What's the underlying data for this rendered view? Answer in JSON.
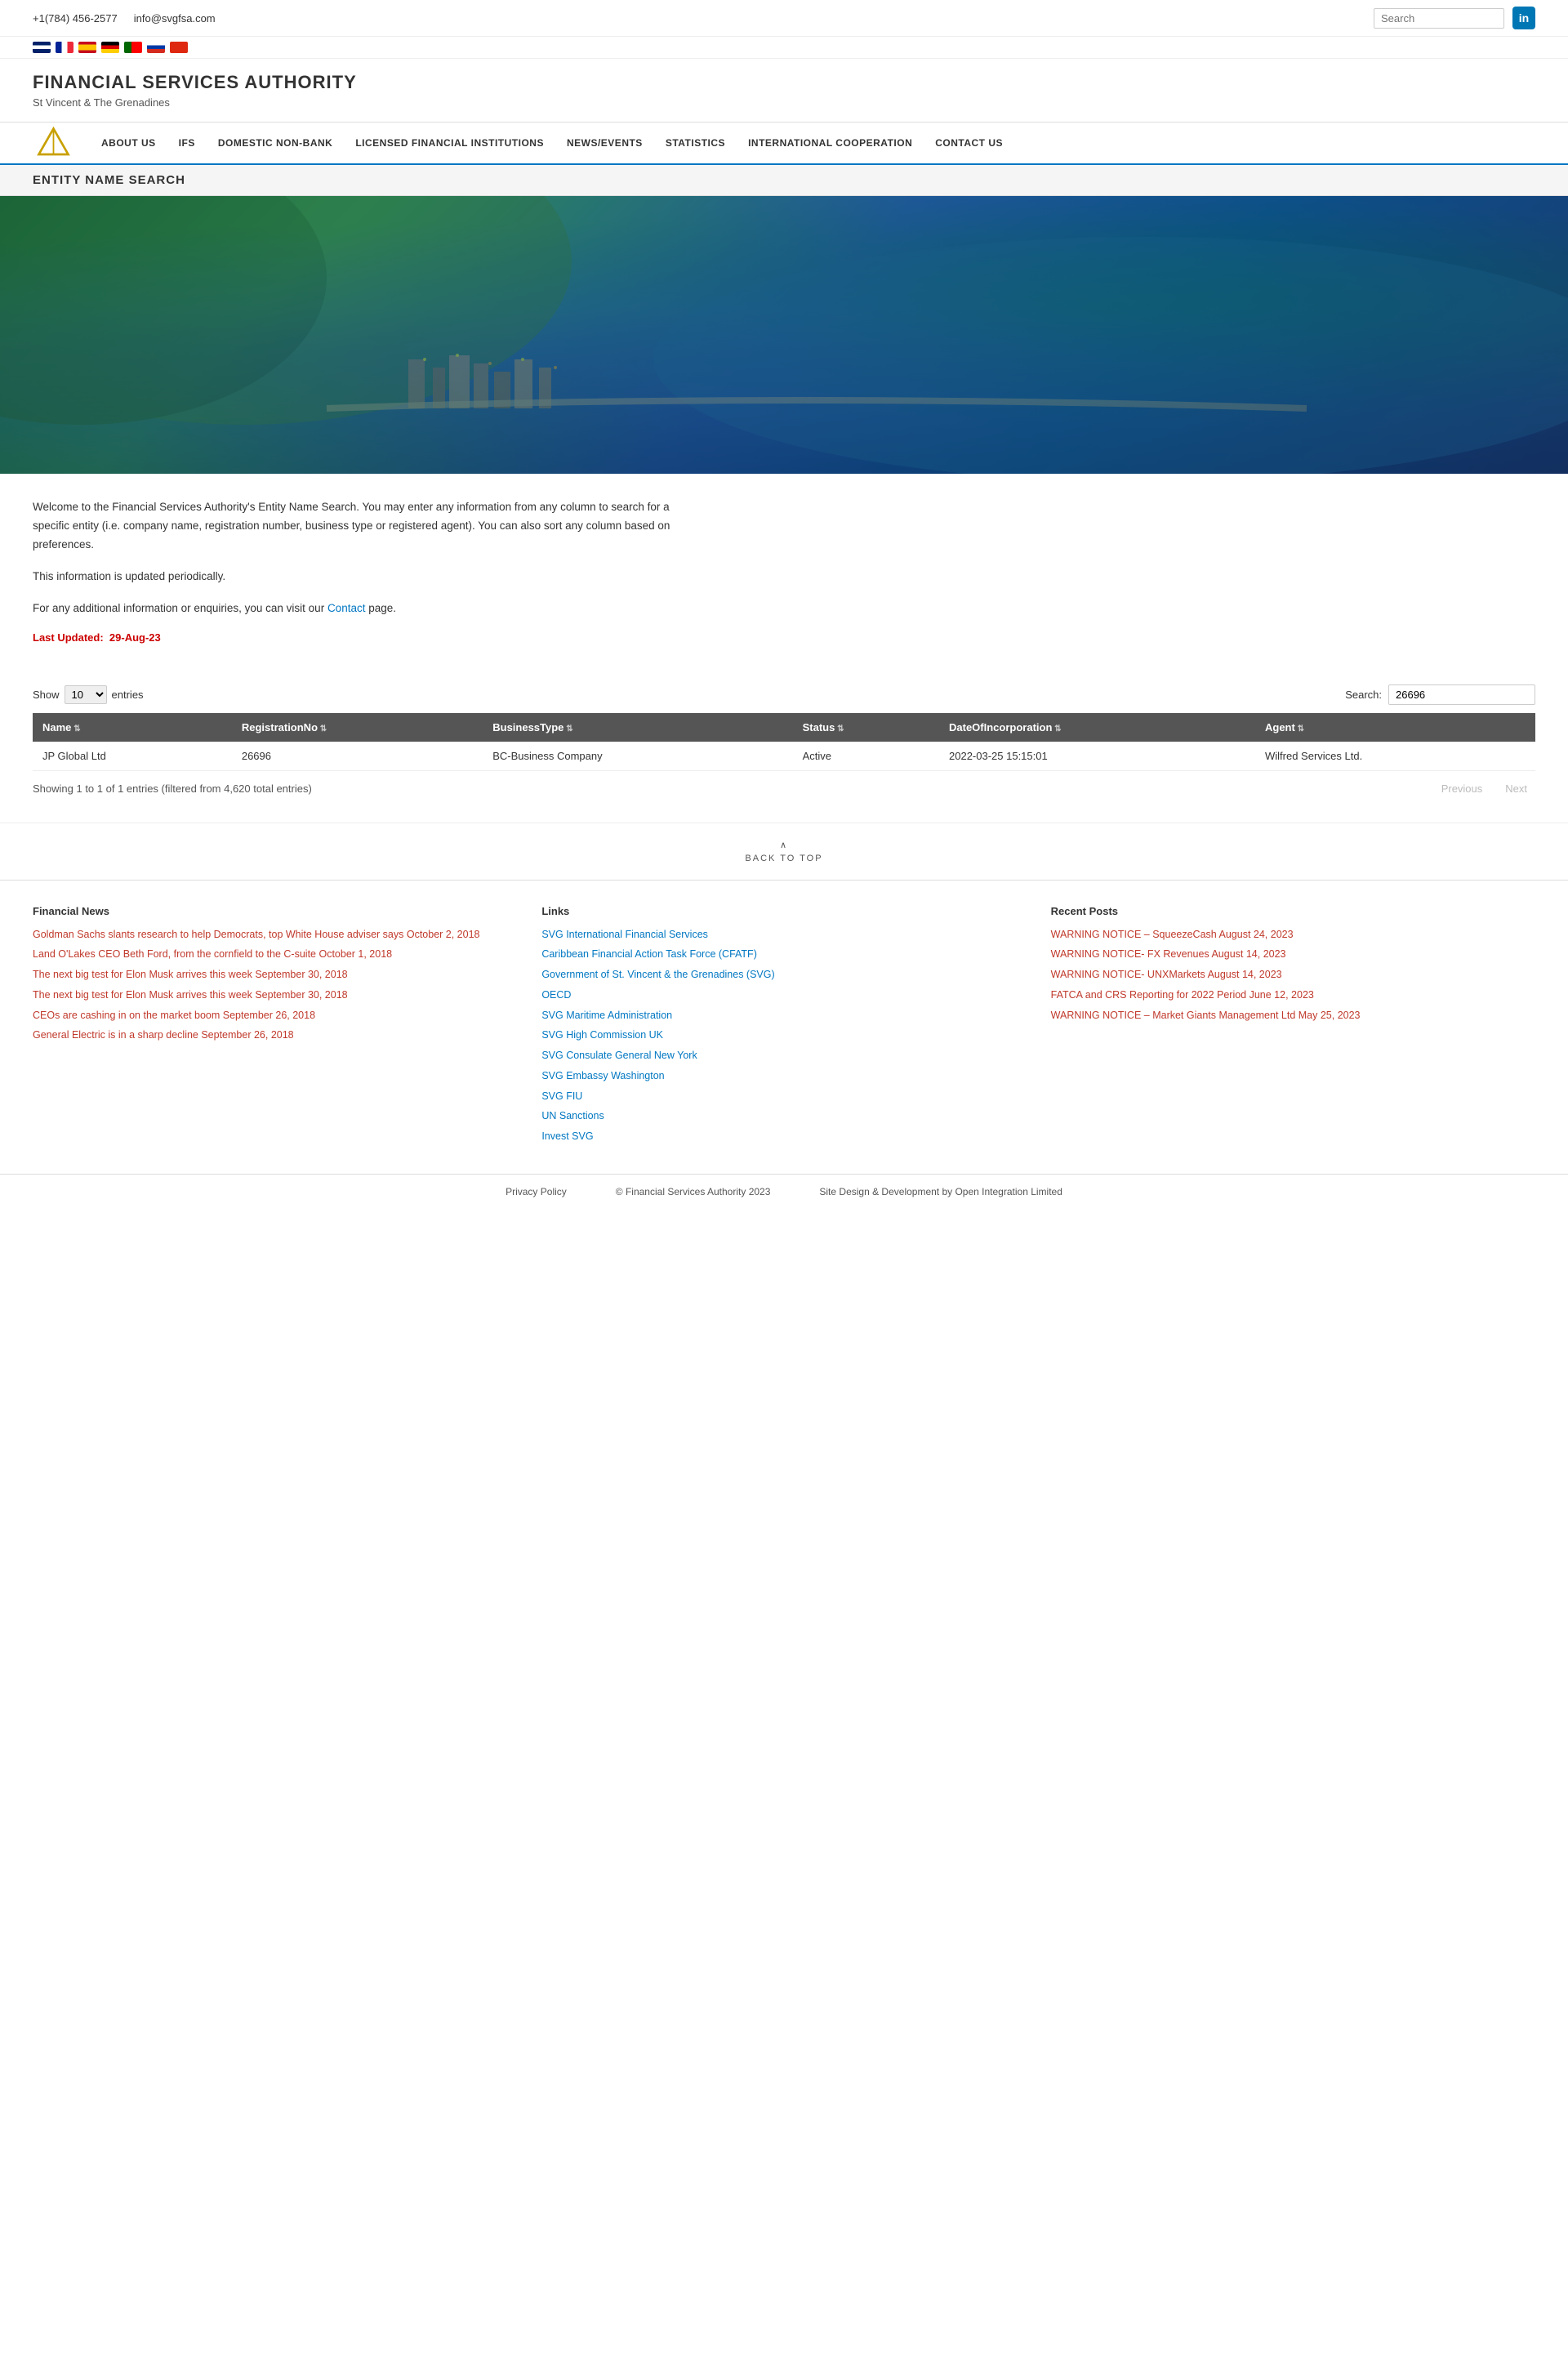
{
  "topbar": {
    "phone": "+1(784) 456-2577",
    "email": "info@svgfsa.com",
    "search_placeholder": "Search",
    "linkedin_label": "in"
  },
  "languages": [
    "EN",
    "FR",
    "ES",
    "DE",
    "PT",
    "RU",
    "CN"
  ],
  "header": {
    "title": "FINANCIAL SERVICES AUTHORITY",
    "subtitle": "St Vincent & The Grenadines"
  },
  "nav": {
    "items": [
      {
        "label": "ABOUT US",
        "id": "about-us"
      },
      {
        "label": "IFS",
        "id": "ifs"
      },
      {
        "label": "DOMESTIC NON-BANK",
        "id": "domestic-non-bank"
      },
      {
        "label": "LICENSED FINANCIAL INSTITUTIONS",
        "id": "licensed-fi"
      },
      {
        "label": "NEWS/EVENTS",
        "id": "news-events"
      },
      {
        "label": "STATISTICS",
        "id": "statistics"
      },
      {
        "label": "INTERNATIONAL COOPERATION",
        "id": "intl-coop"
      },
      {
        "label": "CONTACT US",
        "id": "contact-us"
      }
    ]
  },
  "page_title": "ENTITY NAME SEARCH",
  "intro": {
    "paragraph1": "Welcome to the Financial Services Authority's Entity Name Search. You may enter any information from any column to search for a specific entity (i.e. company name, registration number, business type or registered agent). You can also sort any column based on preferences.",
    "paragraph2": "This information is updated periodically.",
    "paragraph3_prefix": "For any additional information or enquiries, you can visit our ",
    "paragraph3_link": "Contact",
    "paragraph3_suffix": " page.",
    "last_updated_label": "Last Updated:",
    "last_updated_value": "29-Aug-23"
  },
  "table": {
    "show_label": "Show",
    "entries_label": "entries",
    "search_label": "Search:",
    "search_value": "26696",
    "show_value": "10",
    "columns": [
      "Name",
      "RegistrationNo",
      "BusinessType",
      "Status",
      "DateOfIncorporation",
      "Agent"
    ],
    "rows": [
      {
        "name": "JP Global Ltd",
        "reg_no": "26696",
        "business_type": "BC-Business Company",
        "status": "Active",
        "date_inc": "2022-03-25 15:15:01",
        "agent": "Wilfred Services Ltd."
      }
    ],
    "showing_text": "Showing 1 to 1 of 1 entries (filtered from 4,620 total entries)",
    "prev_label": "Previous",
    "next_label": "Next"
  },
  "back_to_top": "BACK TO TOP",
  "footer": {
    "financial_news": {
      "heading": "Financial News",
      "items": [
        {
          "text": "Goldman Sachs slants research to help Democrats, top White House adviser says October 2, 2018",
          "url": "#"
        },
        {
          "text": "Land O'Lakes CEO Beth Ford, from the cornfield to the C-suite October 1, 2018",
          "url": "#"
        },
        {
          "text": "The next big test for Elon Musk arrives this week September 30, 2018",
          "url": "#"
        },
        {
          "text": "The next big test for Elon Musk arrives this week September 30, 2018",
          "url": "#"
        },
        {
          "text": "CEOs are cashing in on the market boom September 26, 2018",
          "url": "#"
        },
        {
          "text": "General Electric is in a sharp decline September 26, 2018",
          "url": "#"
        }
      ]
    },
    "links": {
      "heading": "Links",
      "items": [
        {
          "text": "SVG International Financial Services",
          "url": "#"
        },
        {
          "text": "Caribbean Financial Action Task Force (CFATF)",
          "url": "#"
        },
        {
          "text": "Government of St. Vincent & the Grenadines (SVG)",
          "url": "#"
        },
        {
          "text": "OECD",
          "url": "#"
        },
        {
          "text": "SVG Maritime Administration",
          "url": "#"
        },
        {
          "text": "SVG High Commission UK",
          "url": "#"
        },
        {
          "text": "SVG Consulate General New York",
          "url": "#"
        },
        {
          "text": "SVG Embassy Washington",
          "url": "#"
        },
        {
          "text": "SVG FIU",
          "url": "#"
        },
        {
          "text": "UN Sanctions",
          "url": "#"
        },
        {
          "text": "Invest SVG",
          "url": "#"
        }
      ]
    },
    "recent_posts": {
      "heading": "Recent Posts",
      "items": [
        {
          "text": "WARNING NOTICE – SqueezeCash August 24, 2023",
          "url": "#"
        },
        {
          "text": "WARNING NOTICE- FX Revenues August 14, 2023",
          "url": "#"
        },
        {
          "text": "WARNING NOTICE- UNXMarkets August 14, 2023",
          "url": "#"
        },
        {
          "text": "FATCA and CRS Reporting for 2022 Period June 12, 2023",
          "url": "#"
        },
        {
          "text": "WARNING NOTICE – Market Giants Management Ltd May 25, 2023",
          "url": "#"
        }
      ]
    }
  },
  "bottom_footer": {
    "privacy": "Privacy Policy",
    "copyright": "© Financial Services Authority 2023",
    "dev": "Site Design & Development by Open Integration Limited"
  }
}
